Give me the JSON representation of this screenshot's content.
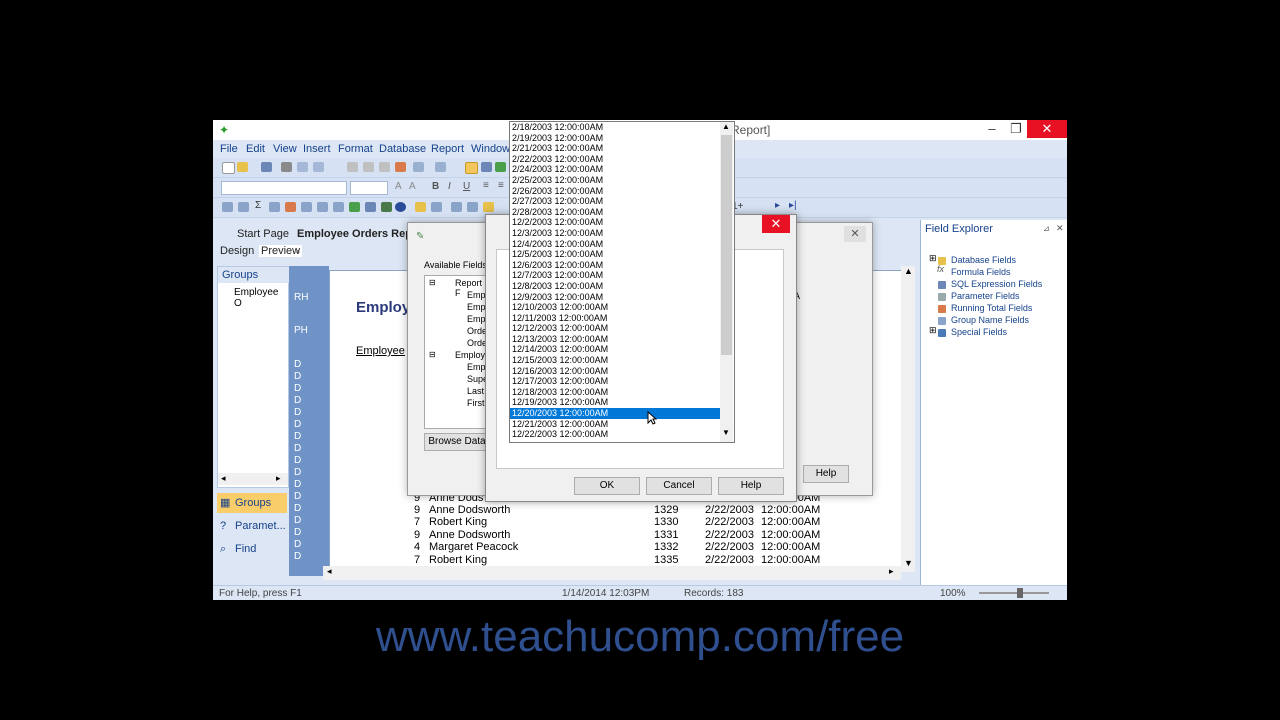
{
  "app": {
    "title": "Report]",
    "menu": [
      "File",
      "Edit",
      "View",
      "Insert",
      "Format",
      "Database",
      "Report",
      "Window"
    ],
    "page_nav": "1+",
    "doc_tabs": [
      "Start Page",
      "Employee Orders Repor"
    ],
    "view_tabs": [
      "Design",
      "Preview"
    ],
    "groups": {
      "header": "Groups",
      "item": "Employee O"
    },
    "nav": {
      "groups": "Groups",
      "parameters": "Paramet...",
      "find": "Find"
    },
    "section_labels": [
      "RH",
      "PH",
      "D",
      "D",
      "D",
      "D",
      "D",
      "D",
      "D",
      "D",
      "D",
      "D",
      "D",
      "D",
      "D",
      "D",
      "D",
      "D",
      "D"
    ],
    "report": {
      "title": "Employ",
      "subtitle": "Employee",
      "rows": [
        {
          "id": "9",
          "name": "Anne Dodsworth",
          "order": "1329",
          "date": "2/22/2003",
          "time": "12:00:00AM"
        },
        {
          "id": "7",
          "name": "Robert King",
          "order": "1330",
          "date": "2/22/2003",
          "time": "12:00:00AM"
        },
        {
          "id": "9",
          "name": "Anne Dodsworth",
          "order": "1331",
          "date": "2/22/2003",
          "time": "12:00:00AM"
        },
        {
          "id": "4",
          "name": "Margaret Peacock",
          "order": "1332",
          "date": "2/22/2003",
          "time": "12:00:00AM"
        },
        {
          "id": "7",
          "name": "Robert King",
          "order": "1335",
          "date": "2/22/2003",
          "time": "12:00:00AM"
        }
      ],
      "partial_row": {
        "id": "9",
        "name": "Anne Dods",
        "time": "12:00:00AM"
      }
    },
    "field_explorer": {
      "title": "Field Explorer",
      "items": [
        "Database Fields",
        "Formula Fields",
        "SQL Expression Fields",
        "Parameter Fields",
        "Running Total Fields",
        "Group Name Fields",
        "Special Fields"
      ]
    },
    "status": {
      "help": "For Help, press F1",
      "datetime": "1/14/2014  12:03PM",
      "records": "Records:  183",
      "zoom": "100%"
    }
  },
  "dialog_back": {
    "available_fields": "Available Fields:",
    "tree": [
      "Report F",
      "Emp",
      "Emp",
      "Emp",
      "Orde",
      "Orde",
      "Employ",
      "Emp",
      "Supe",
      "Last",
      "First"
    ],
    "browse": "Browse Data",
    "help": "Help",
    "partial": "Co",
    "a_letter": "A"
  },
  "dialog_mid": {
    "ok": "OK",
    "cancel": "Cancel",
    "help": "Help"
  },
  "listbox": {
    "items": [
      "2/18/2003 12:00:00AM",
      "2/19/2003 12:00:00AM",
      "2/21/2003 12:00:00AM",
      "2/22/2003 12:00:00AM",
      "2/24/2003 12:00:00AM",
      "2/25/2003 12:00:00AM",
      "2/26/2003 12:00:00AM",
      "2/27/2003 12:00:00AM",
      "2/28/2003 12:00:00AM",
      "12/2/2003 12:00:00AM",
      "12/3/2003 12:00:00AM",
      "12/4/2003 12:00:00AM",
      "12/5/2003 12:00:00AM",
      "12/6/2003 12:00:00AM",
      "12/7/2003 12:00:00AM",
      "12/8/2003 12:00:00AM",
      "12/9/2003 12:00:00AM",
      "12/10/2003 12:00:00AM",
      "12/11/2003 12:00:00AM",
      "12/12/2003 12:00:00AM",
      "12/13/2003 12:00:00AM",
      "12/14/2003 12:00:00AM",
      "12/15/2003 12:00:00AM",
      "12/16/2003 12:00:00AM",
      "12/17/2003 12:00:00AM",
      "12/18/2003 12:00:00AM",
      "12/19/2003 12:00:00AM",
      "12/20/2003 12:00:00AM",
      "12/21/2003 12:00:00AM",
      "12/22/2003 12:00:00AM"
    ],
    "selected": "12/20/2003 12:00:00AM"
  },
  "footer": {
    "url": "www.teachucomp.com/free"
  },
  "colors": {
    "accent": "#15428b",
    "selection": "#0078d7",
    "close": "#e81123",
    "footer": "#2f4f8f"
  }
}
